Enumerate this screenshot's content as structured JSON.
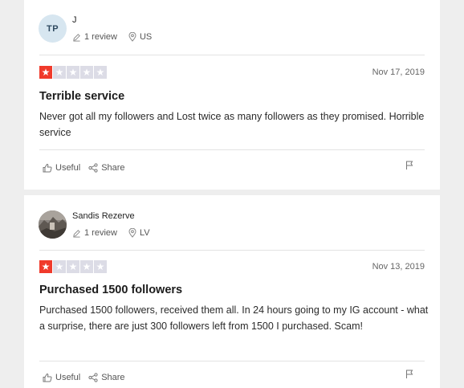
{
  "reviews": [
    {
      "avatar_initials": "TP",
      "name": "J",
      "review_count": "1 review",
      "country": "US",
      "rating": 1,
      "max_rating": 5,
      "date": "Nov 17, 2019",
      "title": "Terrible service",
      "body": "Never got all my followers and Lost twice as many followers as they promised. Horrible service",
      "useful_label": "Useful",
      "share_label": "Share"
    },
    {
      "avatar_initials": "",
      "name": "Sandis Rezerve",
      "review_count": "1 review",
      "country": "LV",
      "rating": 1,
      "max_rating": 5,
      "date": "Nov 13, 2019",
      "title": "Purchased 1500 followers",
      "body": "Purchased 1500 followers, received them all. In 24 hours going to my IG account - what a surprise, there are just 300 followers left from 1500 I purchased. Scam!",
      "useful_label": "Useful",
      "share_label": "Share"
    }
  ],
  "colors": {
    "star_on": "#f03a2b",
    "star_off": "#dcdce6",
    "page_bg": "#eeeeee",
    "avatar_bg": "#d7e6f0"
  }
}
